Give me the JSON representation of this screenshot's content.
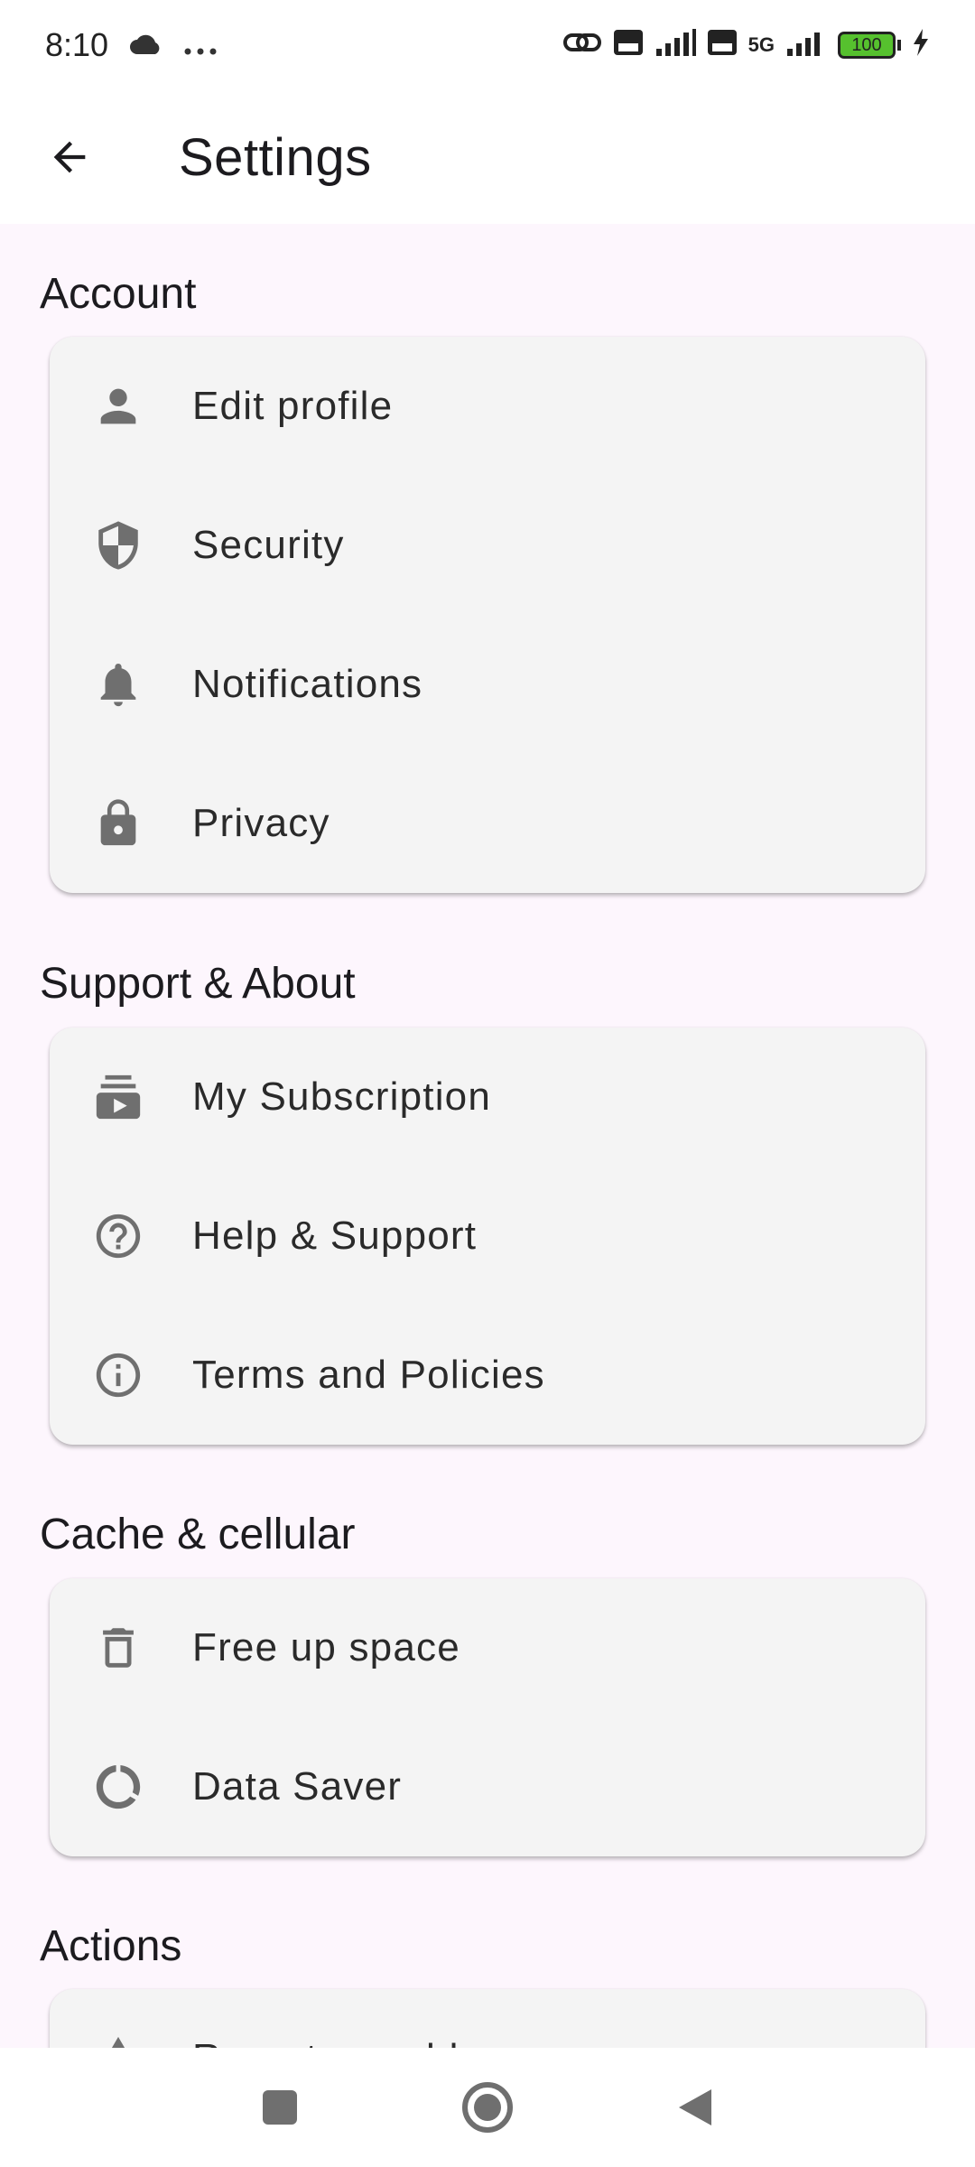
{
  "status_bar": {
    "time": "8:10",
    "battery": "100",
    "network": "5G"
  },
  "app_bar": {
    "title": "Settings"
  },
  "sections": [
    {
      "title": "Account",
      "items": [
        {
          "label": "Edit profile",
          "icon": "person-icon"
        },
        {
          "label": "Security",
          "icon": "shield-icon"
        },
        {
          "label": "Notifications",
          "icon": "bell-icon"
        },
        {
          "label": "Privacy",
          "icon": "lock-icon"
        }
      ]
    },
    {
      "title": "Support & About",
      "items": [
        {
          "label": "My Subscription",
          "icon": "subscriptions-icon"
        },
        {
          "label": "Help & Support",
          "icon": "help-icon"
        },
        {
          "label": "Terms and Policies",
          "icon": "info-icon"
        }
      ]
    },
    {
      "title": "Cache & cellular",
      "items": [
        {
          "label": "Free up space",
          "icon": "trash-icon"
        },
        {
          "label": "Data Saver",
          "icon": "data-saver-icon"
        }
      ]
    },
    {
      "title": "Actions",
      "items": [
        {
          "label": "Report a problem",
          "icon": "warning-icon"
        }
      ]
    }
  ],
  "colors": {
    "background": "#fdf6fd",
    "card": "#f4f4f4",
    "icon": "#6f6f6f",
    "text": "#1c1b1f"
  }
}
